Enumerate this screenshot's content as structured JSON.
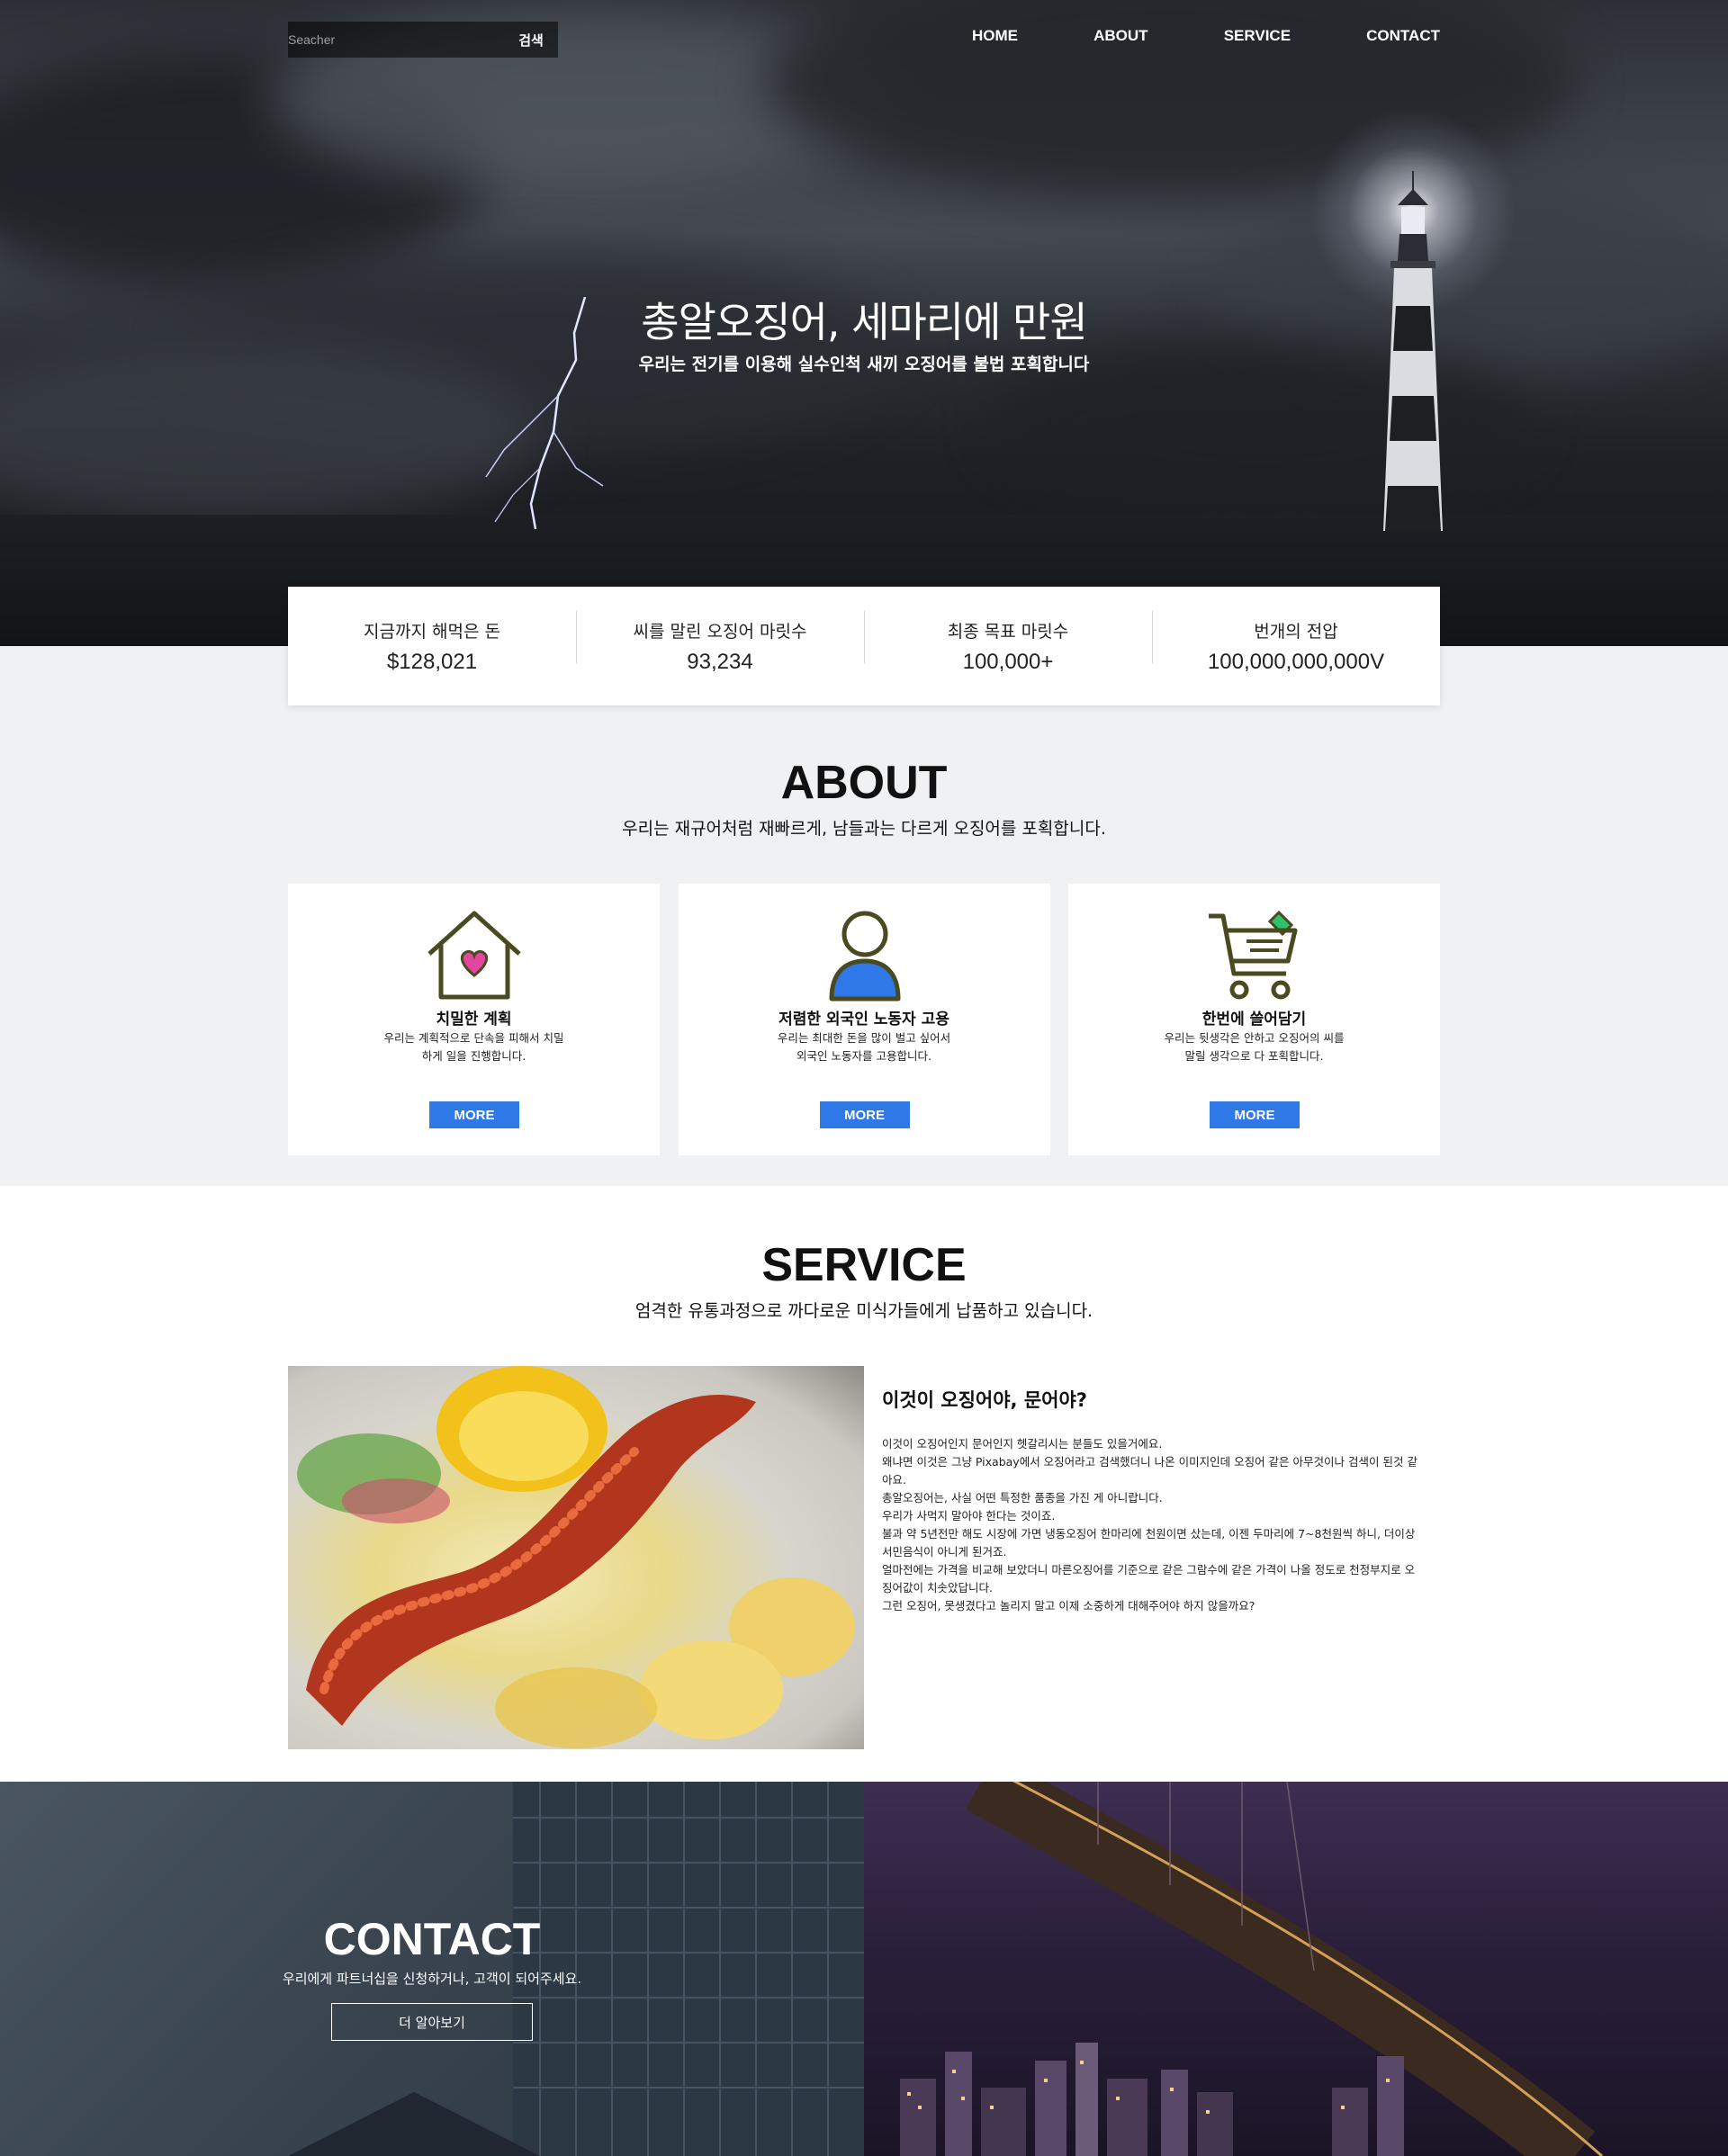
{
  "search": {
    "placeholder": "Seacher",
    "button_label": "검색"
  },
  "nav": {
    "items": [
      {
        "label": "HOME"
      },
      {
        "label": "ABOUT"
      },
      {
        "label": "SERVICE"
      },
      {
        "label": "CONTACT"
      }
    ]
  },
  "hero": {
    "title": "총알오징어, 세마리에 만원",
    "subtitle": "우리는 전기를 이용해 실수인척 새끼 오징어를 불법 포획합니다"
  },
  "stats": [
    {
      "label": "지금까지 해먹은 돈",
      "value": "$128,021"
    },
    {
      "label": "씨를 말린 오징어 마릿수",
      "value": "93,234"
    },
    {
      "label": "최종 목표 마릿수",
      "value": "100,000+"
    },
    {
      "label": "번개의 전압",
      "value": "100,000,000,000V"
    }
  ],
  "about": {
    "title": "ABOUT",
    "subtitle": "우리는 재규어처럼 재빠르게, 남들과는 다르게 오징어를 포획합니다.",
    "cards": [
      {
        "icon": "home-heart-icon",
        "title": "치밀한 계획",
        "desc": "우리는 계획적으로 단속을 피해서 치밀하게 일을 진행합니다.",
        "button": "MORE"
      },
      {
        "icon": "user-icon",
        "title": "저렴한 외국인 노동자 고용",
        "desc": "우리는 최대한 돈을 많이 벌고 싶어서 외국인 노동자를 고용합니다.",
        "button": "MORE"
      },
      {
        "icon": "cart-icon",
        "title": "한번에 쓸어담기",
        "desc": "우리는 뒷생각은 안하고 오징어의 씨를 말릴 생각으로 다 포획합니다.",
        "button": "MORE"
      }
    ]
  },
  "service": {
    "title": "SERVICE",
    "subtitle": "엄격한 유통과정으로 까다로운 미식가들에게 납품하고 있습니다.",
    "heading": "이것이 오징어야, 문어야?",
    "paragraphs": [
      "이것이 오징어인지 문어인지 헷갈리시는 분들도 있을거에요.",
      "왜냐면 이것은 그냥 Pixabay에서 오징어라고 검색했더니 나온 이미지인데 오징어 같은 아무것이나 검색이 된것 같아요.",
      "총알오징어는, 사실 어떤 특정한 품종을 가진 게 아니랍니다.",
      "우리가 사먹지 말아야 한다는 것이죠.",
      "불과 약 5년전만 해도 시장에 가면 냉동오징어 한마리에 천원이면 샀는데, 이젠 두마리에 7~8천원씩 하니, 더이상 서민음식이 아니게 된거죠.",
      "얼마전에는 가격을 비교해 보았더니 마른오징어를 기준으로 같은 그람수에 같은 가격이 나올 정도로 천정부지로 오징어값이 치솟았답니다.",
      "그런 오징어, 못생겼다고 놀리지 말고 이제 소중하게 대해주어야 하지 않을까요?"
    ]
  },
  "contact": {
    "title": "CONTACT",
    "subtitle": "우리에게 파트너십을 신청하거나, 고객이 되어주세요.",
    "button": "더 알아보기"
  },
  "colors": {
    "accent": "#2f78e8",
    "section_bg": "#f0f1f3",
    "icon_stroke": "#4a4a20"
  }
}
